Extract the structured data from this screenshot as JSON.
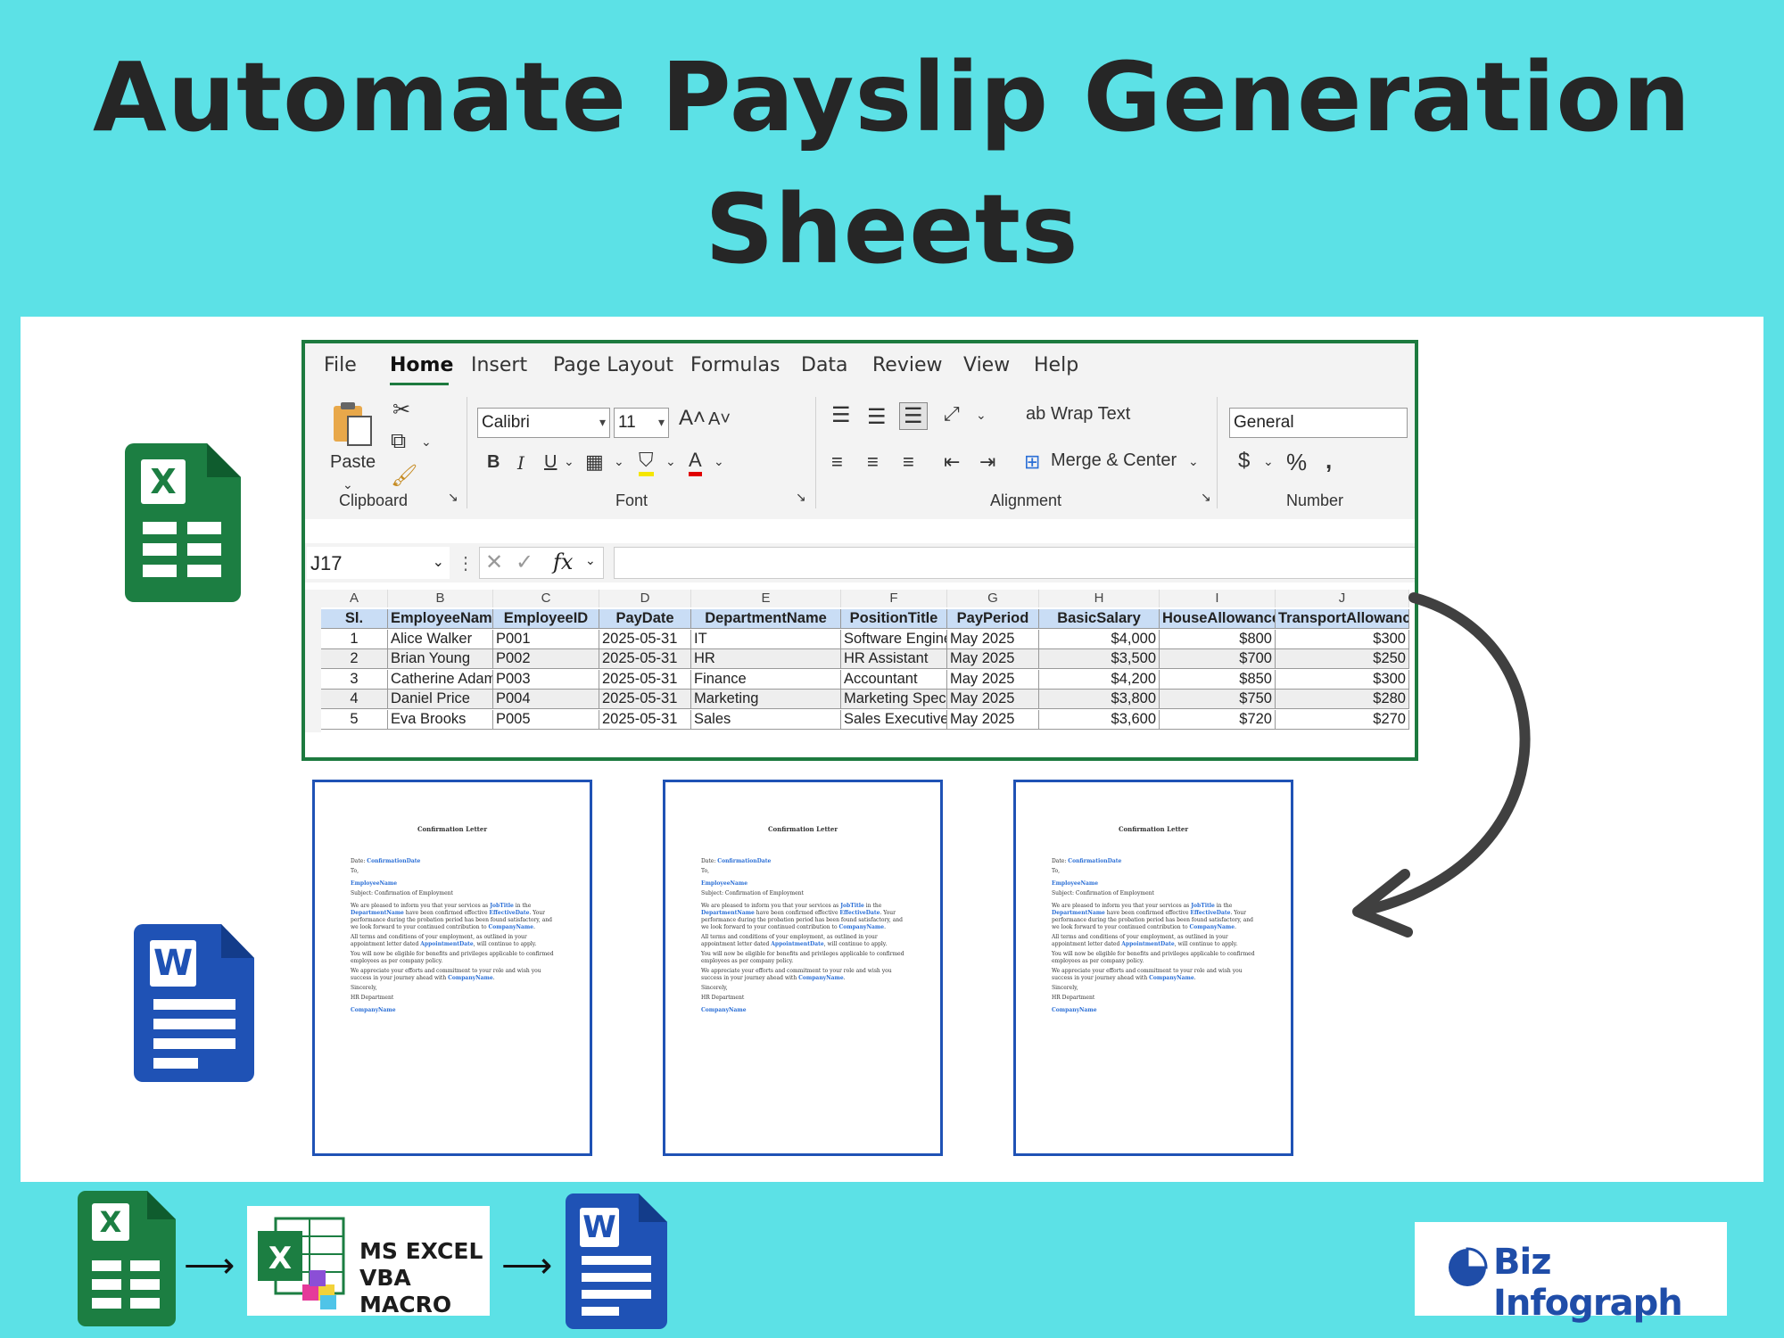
{
  "headline": {
    "line1": "Automate Payslip Generation",
    "line2": "Sheets"
  },
  "colors": {
    "background": "#5ce1e6",
    "excel_green": "#1c7e42",
    "word_blue": "#1f52b5",
    "header_fill": "#c9ddf5"
  },
  "icons": {
    "excel": "excel-icon",
    "word": "word-icon",
    "excel_letter": "X",
    "word_letter": "W"
  },
  "excel": {
    "menu": [
      "File",
      "Home",
      "Insert",
      "Page Layout",
      "Formulas",
      "Data",
      "Review",
      "View",
      "Help"
    ],
    "ribbon": {
      "paste": "Paste",
      "font_name": "Calibri",
      "font_size": "11",
      "wrap_text": "Wrap Text",
      "merge_center": "Merge & Center",
      "number_format": "General",
      "groups": {
        "clipboard": "Clipboard",
        "font": "Font",
        "alignment": "Alignment",
        "number": "Number"
      }
    },
    "name_box": "J17",
    "fx": "fx",
    "columns": [
      "A",
      "B",
      "C",
      "D",
      "E",
      "F",
      "G",
      "H",
      "I",
      "J"
    ],
    "headers": [
      "Sl.",
      "EmployeeName",
      "EmployeeID",
      "PayDate",
      "DepartmentName",
      "PositionTitle",
      "PayPeriod",
      "BasicSalary",
      "HouseAllowance",
      "TransportAllowance"
    ],
    "rows": [
      [
        "1",
        "Alice Walker",
        "P001",
        "2025-05-31",
        "IT",
        "Software Engineer",
        "May 2025",
        "$4,000",
        "$800",
        "$300"
      ],
      [
        "2",
        "Brian Young",
        "P002",
        "2025-05-31",
        "HR",
        "HR Assistant",
        "May 2025",
        "$3,500",
        "$700",
        "$250"
      ],
      [
        "3",
        "Catherine Adams",
        "P003",
        "2025-05-31",
        "Finance",
        "Accountant",
        "May 2025",
        "$4,200",
        "$850",
        "$300"
      ],
      [
        "4",
        "Daniel Price",
        "P004",
        "2025-05-31",
        "Marketing",
        "Marketing Specialist",
        "May 2025",
        "$3,800",
        "$750",
        "$280"
      ],
      [
        "5",
        "Eva Brooks",
        "P005",
        "2025-05-31",
        "Sales",
        "Sales Executive",
        "May 2025",
        "$3,600",
        "$720",
        "$270"
      ]
    ]
  },
  "letter": {
    "title": "Confirmation Letter",
    "date_label": "Date:",
    "date_ph": "ConfirmationDate",
    "to": "To,",
    "employee_ph": "EmployeeName",
    "subject": "Subject: Confirmation of Employment",
    "p1a": "We are pleased to inform you that your services as",
    "job_ph": "JobTitle",
    "p1b": "in the",
    "dept_ph": "DepartmentName",
    "p1c": "have been confirmed effective",
    "eff_ph": "EffectiveDate",
    "p1d": ". Your performance during the probation period has been found satisfactory, and we look forward to your continued contribution to",
    "company_ph": "CompanyName",
    "p2a": "All terms and conditions of your employment, as outlined in your appointment letter dated",
    "appt_ph": "AppointmentDate",
    "p2b": ", will continue to apply.",
    "p3": "You will now be eligible for benefits and privileges applicable to confirmed employees as per company policy.",
    "p4a": "We appreciate your efforts and commitment to your role and wish you success in your journey ahead with",
    "sincerely": "Sincerely,",
    "hr": "HR Department"
  },
  "bottom": {
    "macro_line1": "MS EXCEL",
    "macro_line2": "VBA MACRO",
    "flow_arrow": "⟶",
    "brand": "Biz Infograph"
  }
}
